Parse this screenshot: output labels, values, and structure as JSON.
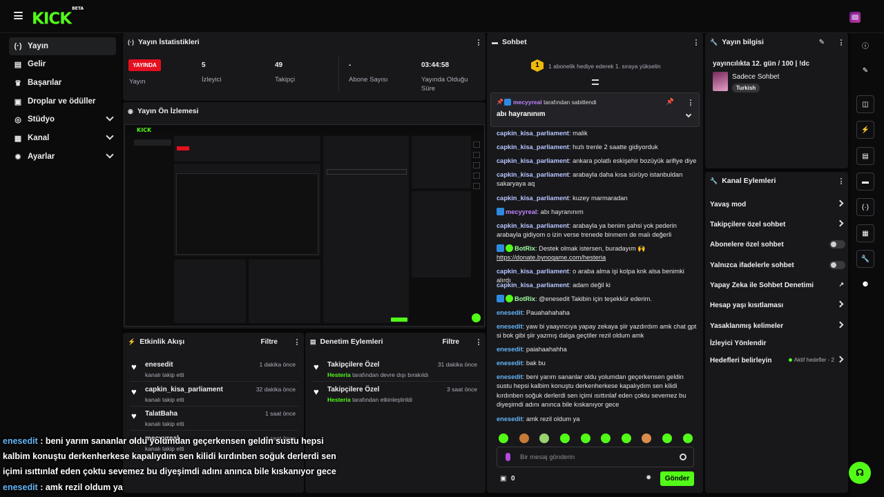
{
  "brand": {
    "logo": "KICK",
    "beta": "BETA",
    "accent": "#53fc18"
  },
  "sidebar": {
    "items": [
      {
        "label": "Yayın",
        "icon": "broadcast-icon",
        "active": true
      },
      {
        "label": "Gelir",
        "icon": "revenue-icon"
      },
      {
        "label": "Başarılar",
        "icon": "trophy-icon"
      },
      {
        "label": "Droplar ve ödüller",
        "icon": "gift-icon"
      },
      {
        "label": "Stüdyo",
        "icon": "studio-icon",
        "expandable": true
      },
      {
        "label": "Kanal",
        "icon": "channel-icon",
        "expandable": true
      },
      {
        "label": "Ayarlar",
        "icon": "gear-icon",
        "expandable": true
      }
    ]
  },
  "stats": {
    "title": "Yayın İstatistikleri",
    "live_badge": "YAYINDA",
    "live_label": "Yayın",
    "viewers_value": "5",
    "viewers_label": "İzleyici",
    "followers_value": "49",
    "followers_label": "Takipçi",
    "subs_value": "-",
    "subs_label": "Abone Sayısı",
    "uptime_value": "03:44:58",
    "uptime_label": "Yayında Olduğu Süre"
  },
  "preview": {
    "title": "Yayın Ön İzlemesi"
  },
  "activity": {
    "title": "Etkinlik Akışı",
    "filter": "Filtre",
    "items": [
      {
        "name": "enesedit",
        "sub": "kanalı takip etti",
        "time": "1 dakika önce"
      },
      {
        "name": "capkin_kisa_parliament",
        "sub": "kanalı takip etti",
        "time": "32 dakika önce"
      },
      {
        "name": "TalatBaha",
        "sub": "kanalı takip etti",
        "time": "1 saat önce"
      },
      {
        "name": "mecyyreal",
        "sub": "kanalı takip etti",
        "time": "3 saat önce"
      }
    ]
  },
  "moderation": {
    "title": "Denetim Eylemleri",
    "filter": "Filtre",
    "items": [
      {
        "name": "Takipçilere Özel",
        "actor": "Hesteria",
        "sub": "tarafından devre dışı bırakıldı",
        "time": "31 dakika önce"
      },
      {
        "name": "Takipçilere Özel",
        "actor": "Hesteria",
        "sub": "tarafından etkinleştirildi",
        "time": "3 saat önce"
      }
    ]
  },
  "chat": {
    "title": "Sohbet",
    "gift_rank": "1",
    "gift_text": "1 abonelik hediye ederek 1. sıraya yükselin",
    "pinned_by": "mecyyreal",
    "pinned_suffix": "tarafından sabitlendi",
    "pinned_message": "abı hayranınım",
    "messages": [
      {
        "user": "capkin_kisa_parliament",
        "text": "malik"
      },
      {
        "user": "capkin_kisa_parliament",
        "text": "hızlı trenle 2 saatte gidiyorduk"
      },
      {
        "user": "capkin_kisa_parliament",
        "text": "ankara polatlı eskişehir bozüyük arifiye diye"
      },
      {
        "user": "capkin_kisa_parliament",
        "text": "arabayla daha kısa sürüyo istanbuldan sakaryaya aq"
      },
      {
        "user": "capkin_kisa_parliament",
        "text": "kuzey marmaradan"
      },
      {
        "user": "mecyyreal",
        "text": "abı hayranınım"
      },
      {
        "user": "capkin_kisa_parliament",
        "text": "arabayla ya benim şahsi yok pederin arabayla gidiyom o izin verse trenede binmem de malı değerli"
      },
      {
        "user": "BotRix",
        "text": "Destek olmak istersen, buradayım 🙌 ",
        "link": "https://donate.bynogame.com/hesteria"
      },
      {
        "user": "capkin_kisa_parliament",
        "text": "o araba alma işi kolpa knk alsa benimki alırdı"
      },
      {
        "user": "capkin_kisa_parliament",
        "text": "adam değil ki"
      },
      {
        "user": "BotRix",
        "text": "@enesedit Takibin için teşekkür ederim."
      },
      {
        "user": "enesedit",
        "text": "Pauahahahaha"
      },
      {
        "user": "enesedit",
        "text": "yaw bi yaayıncıya yapay zekaya şiir yazdırdım amk chat gpt si bok gibi şiir yazmış dalga geçtiler rezil oldum amk"
      },
      {
        "user": "enesedit",
        "text": "paiahaahahha"
      },
      {
        "user": "enesedit",
        "text": "bak bu"
      },
      {
        "user": "enesedit",
        "text": "beni yarım sananlar oldu yolumdan geçerkensen geldin sustu hepsi kalbim konuştu derkenherkese kapalıydım sen kilidi kırdınben soğuk derlerdi sen içimi ısıttınlaf eden çoktu sevemez bu diyeşimdi adını anınca bile kıskanıyor gece"
      },
      {
        "user": "enesedit",
        "text": "amk rezil oldum ya"
      }
    ],
    "input_placeholder": "Bir mesaj gönderin",
    "points": "0",
    "send": "Gönder"
  },
  "stream_info": {
    "title": "Yayın bilgisi",
    "stream_title": "yayıncılıkta 12. gün / 100 | !dc",
    "category": "Sadece Sohbet",
    "tag": "Turkish"
  },
  "channel_actions": {
    "title": "Kanal Eylemleri",
    "items": [
      {
        "label": "Yavaş mod",
        "control": "chevron"
      },
      {
        "label": "Takipçilere özel sohbet",
        "control": "chevron"
      },
      {
        "label": "Abonelere özel sohbet",
        "control": "toggle"
      },
      {
        "label": "Yalnızca ifadelerle sohbet",
        "control": "toggle"
      },
      {
        "label": "Yapay Zeka ile Sohbet Denetimi",
        "control": "external"
      },
      {
        "label": "Hesap yaşı kısıtlaması",
        "control": "chevron"
      },
      {
        "label": "Yasaklanmış kelimeler",
        "control": "chevron"
      },
      {
        "label": "İzleyici Yönlendir",
        "control": "none"
      },
      {
        "label": "Hedefleri belirleyin",
        "control": "chevron",
        "status": "Aktif hedefler - 2"
      }
    ]
  },
  "overlay": {
    "line1_user": "enesedit",
    "line1_text": " : beni yarım sananlar oldu yolumdan geçerkensen geldin sustu hepsi",
    "line2_text": "kalbim konuştu derkenherkese kapalıydım sen kilidi kırdınben soğuk derlerdi sen",
    "line3_text": "içimi ısıttınlaf eden çoktu sevemez bu diyeşimdi adını anınca bile kıskanıyor gece",
    "line4_user": "enesedit",
    "line4_text": " : amk rezil oldum ya"
  }
}
